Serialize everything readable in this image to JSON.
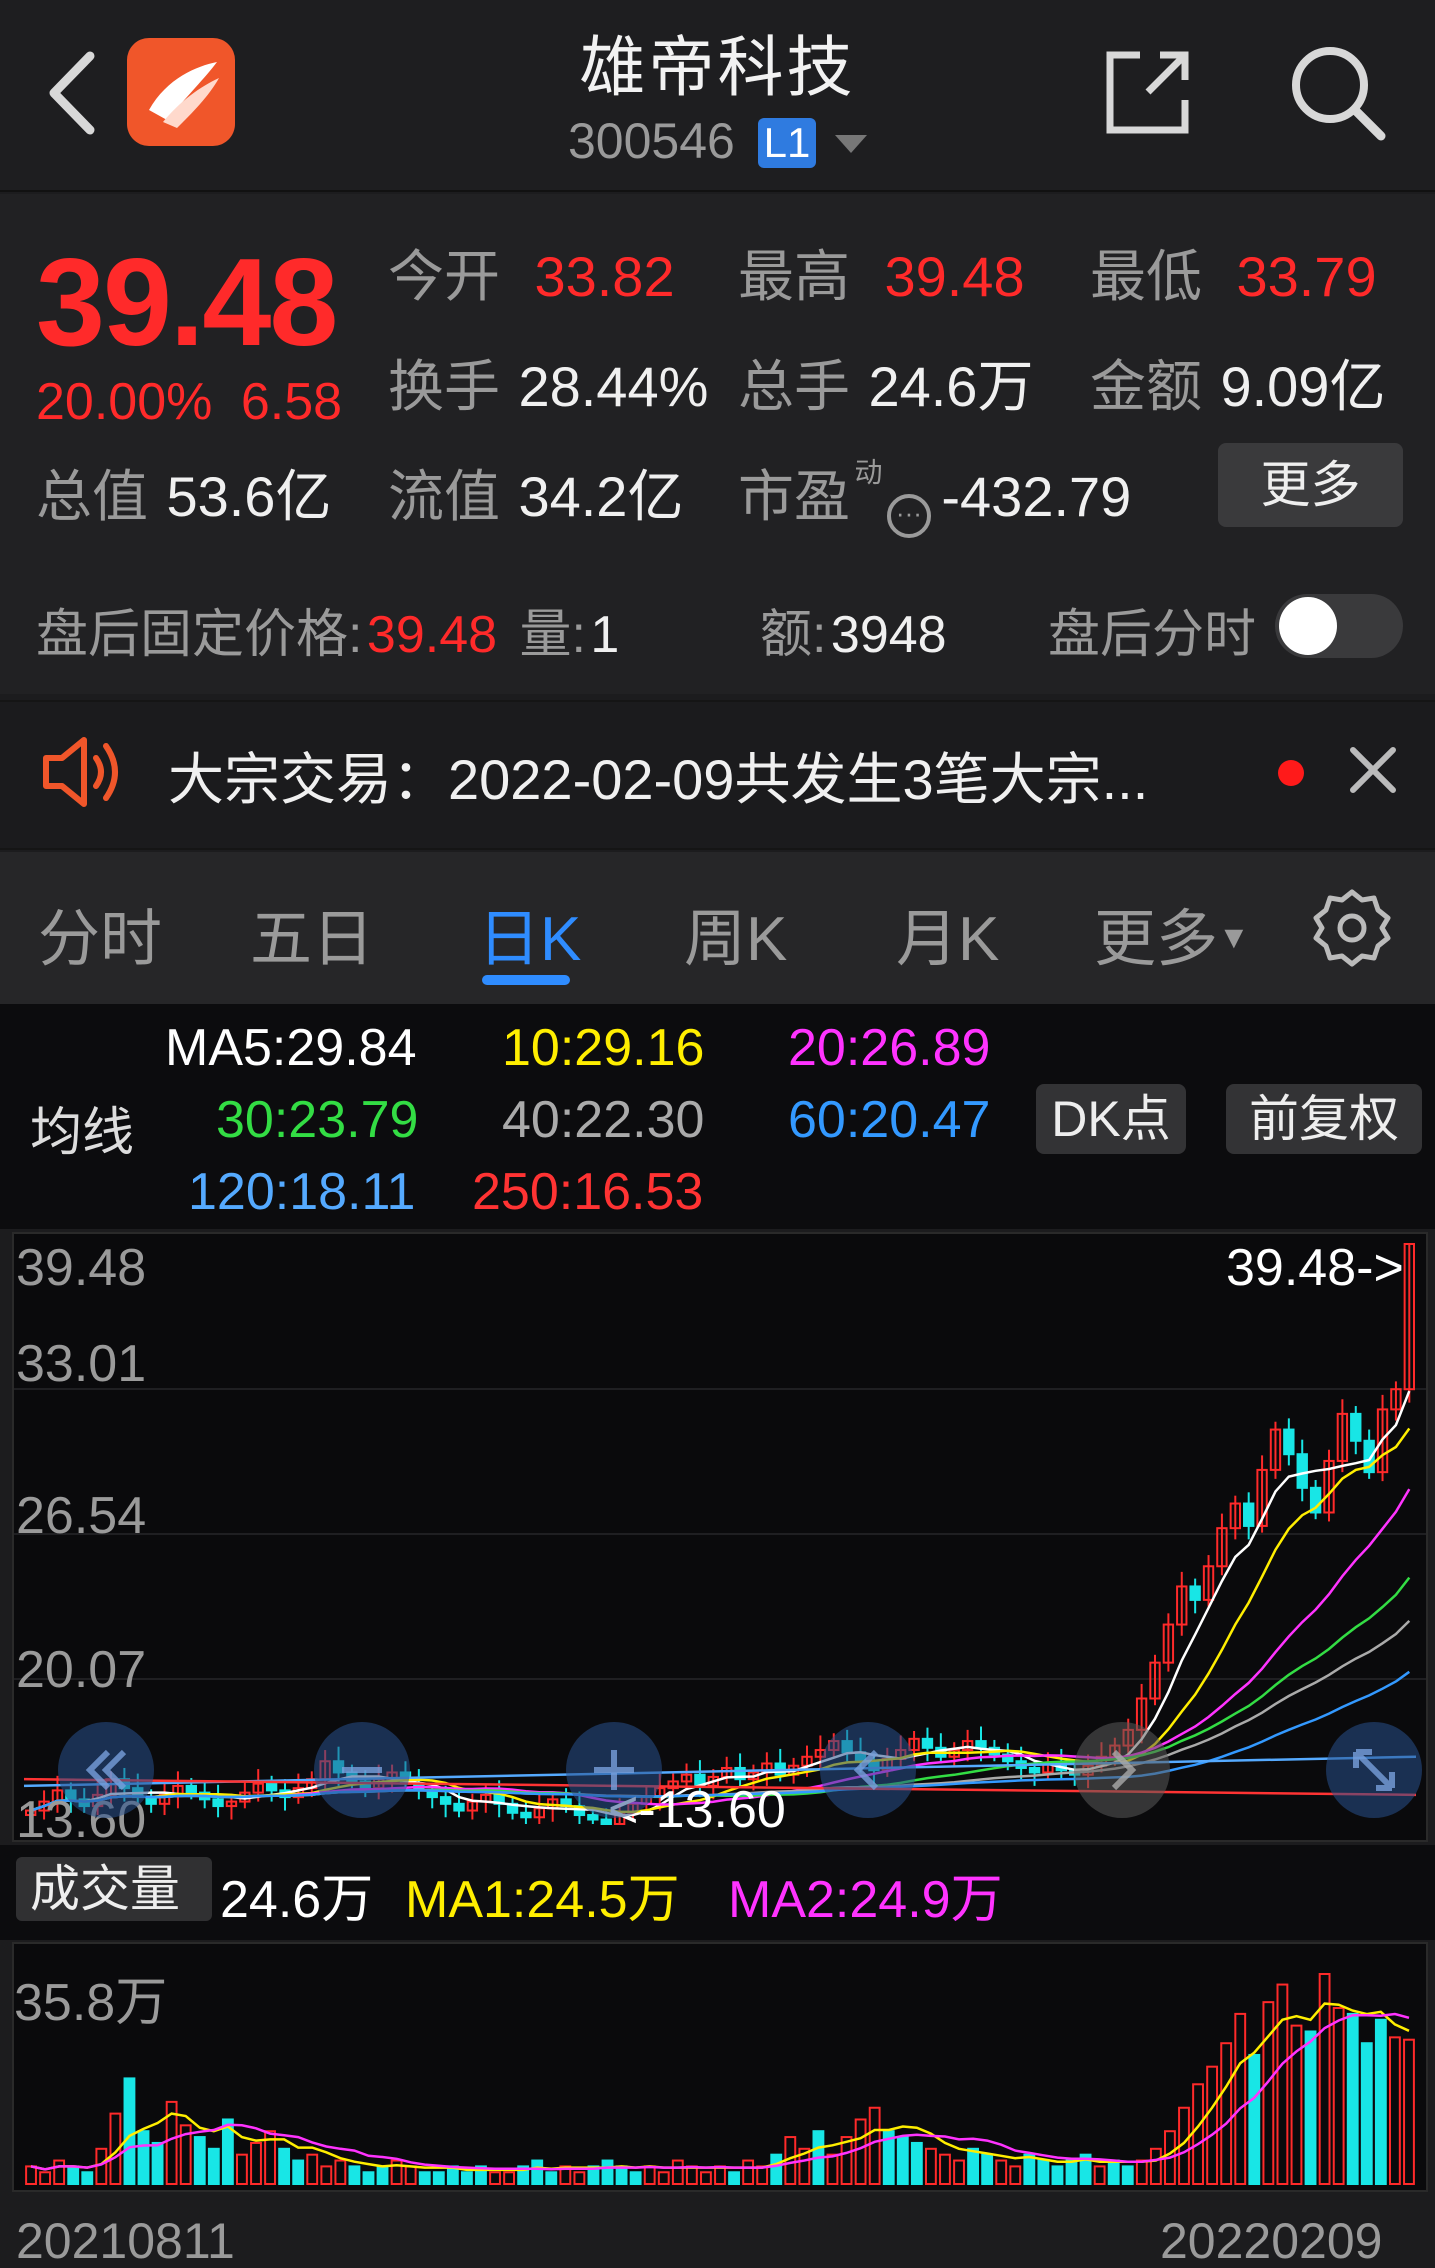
{
  "header": {
    "title": "雄帝科技",
    "code": "300546",
    "level_badge": "L1"
  },
  "quote": {
    "price": "39.48",
    "change_pct": "20.00%",
    "change_amt": "6.58",
    "open_label": "今开",
    "open": "33.82",
    "high_label": "最高",
    "high": "39.48",
    "low_label": "最低",
    "low": "33.79",
    "turnover_label": "换手",
    "turnover": "28.44%",
    "volume_label": "总手",
    "volume": "24.6万",
    "amount_label": "金额",
    "amount": "9.09亿",
    "mktcap_label": "总值",
    "mktcap": "53.6亿",
    "float_label": "流值",
    "float_cap": "34.2亿",
    "pe_label": "市盈",
    "pe_sup": "动",
    "pe": "-432.79",
    "more_label": "更多"
  },
  "after_hours": {
    "price_label": "盘后固定价格:",
    "price": "39.48",
    "vol_label": "量:",
    "vol": "1",
    "amt_label": "额:",
    "amt": "3948",
    "toggle_label": "盘后分时",
    "toggle_on": false
  },
  "news": {
    "text": "大宗交易：2022-02-09共发生3笔大宗..."
  },
  "tabs": [
    {
      "label": "分时",
      "active": false
    },
    {
      "label": "五日",
      "active": false
    },
    {
      "label": "日K",
      "active": true
    },
    {
      "label": "周K",
      "active": false
    },
    {
      "label": "月K",
      "active": false
    },
    {
      "label": "更多",
      "active": false
    }
  ],
  "ma_legend": {
    "title": "均线",
    "ma5": "MA5:29.84",
    "ma10": "10:29.16",
    "ma20": "20:26.89",
    "ma30": "30:23.79",
    "ma40": "40:22.30",
    "ma60": "60:20.47",
    "ma120": "120:18.11",
    "ma250": "250:16.53",
    "dk_label": "DK点",
    "adjust_label": "前复权",
    "colors": {
      "ma5": "#ffffff",
      "ma10": "#ffee00",
      "ma20": "#ff33ff",
      "ma30": "#33dd44",
      "ma40": "#aaaaaa",
      "ma60": "#3399ff",
      "ma120": "#55aaff",
      "ma250": "#ff3333"
    }
  },
  "kchart": {
    "y_labels": [
      "39.48",
      "33.01",
      "26.54",
      "20.07",
      "13.60"
    ],
    "last_price_tag": "39.48->",
    "min_tag": "<-13.60"
  },
  "volume": {
    "selector_label": "成交量",
    "value": "24.6万",
    "ma1": "MA1:24.5万",
    "ma2": "MA2:24.9万",
    "y_max": "35.8万",
    "date_start": "20210811",
    "date_end": "20220209"
  },
  "chart_data": {
    "type": "candlestick",
    "ylim": [
      13.6,
      39.48
    ],
    "close": [
      14.2,
      14.6,
      15.1,
      14.7,
      14.4,
      14.9,
      15.6,
      15.2,
      14.8,
      14.5,
      14.9,
      15.3,
      15.0,
      14.7,
      14.4,
      14.6,
      15.0,
      15.4,
      15.1,
      14.8,
      15.2,
      15.6,
      16.4,
      15.9,
      15.5,
      15.2,
      15.6,
      15.9,
      15.4,
      15.1,
      14.8,
      14.5,
      14.2,
      14.6,
      14.9,
      14.5,
      14.1,
      13.9,
      14.3,
      14.7,
      14.4,
      14.0,
      13.8,
      13.6,
      14.1,
      14.5,
      14.8,
      15.2,
      15.5,
      15.8,
      15.3,
      15.7,
      16.1,
      15.6,
      15.9,
      16.3,
      15.8,
      16.2,
      16.6,
      16.9,
      17.3,
      16.8,
      16.4,
      16.0,
      16.5,
      16.9,
      17.4,
      17.0,
      16.6,
      16.9,
      17.3,
      17.0,
      16.7,
      16.4,
      16.1,
      15.9,
      16.3,
      16.0,
      15.8,
      16.2,
      16.6,
      17.1,
      17.8,
      19.2,
      20.8,
      22.5,
      24.2,
      23.6,
      25.1,
      26.8,
      27.9,
      26.9,
      29.4,
      31.2,
      30.1,
      28.6,
      27.5,
      29.8,
      31.9,
      30.7,
      29.3,
      32.1,
      33.0,
      39.48
    ],
    "volume_scale_max_wan": 35.8,
    "volume_wan": [
      3,
      2,
      4,
      3,
      2,
      6,
      12,
      18,
      9,
      7,
      14,
      10,
      8,
      6,
      11,
      5,
      7,
      9,
      6,
      4,
      5,
      3,
      4,
      3,
      2,
      3,
      4,
      3,
      2,
      2,
      3,
      2,
      3,
      2,
      2,
      3,
      4,
      2,
      3,
      2,
      3,
      4,
      3,
      2,
      3,
      2,
      4,
      3,
      2,
      3,
      2,
      4,
      3,
      5,
      8,
      6,
      9,
      5,
      8,
      11,
      13,
      9,
      8,
      7,
      6,
      5,
      4,
      6,
      5,
      4,
      3,
      5,
      4,
      3,
      4,
      5,
      3,
      4,
      3,
      4,
      6,
      9,
      13,
      17,
      20,
      24,
      29,
      22,
      31,
      34,
      27,
      26,
      35.8,
      30,
      29,
      24,
      28,
      25,
      24.6
    ]
  }
}
